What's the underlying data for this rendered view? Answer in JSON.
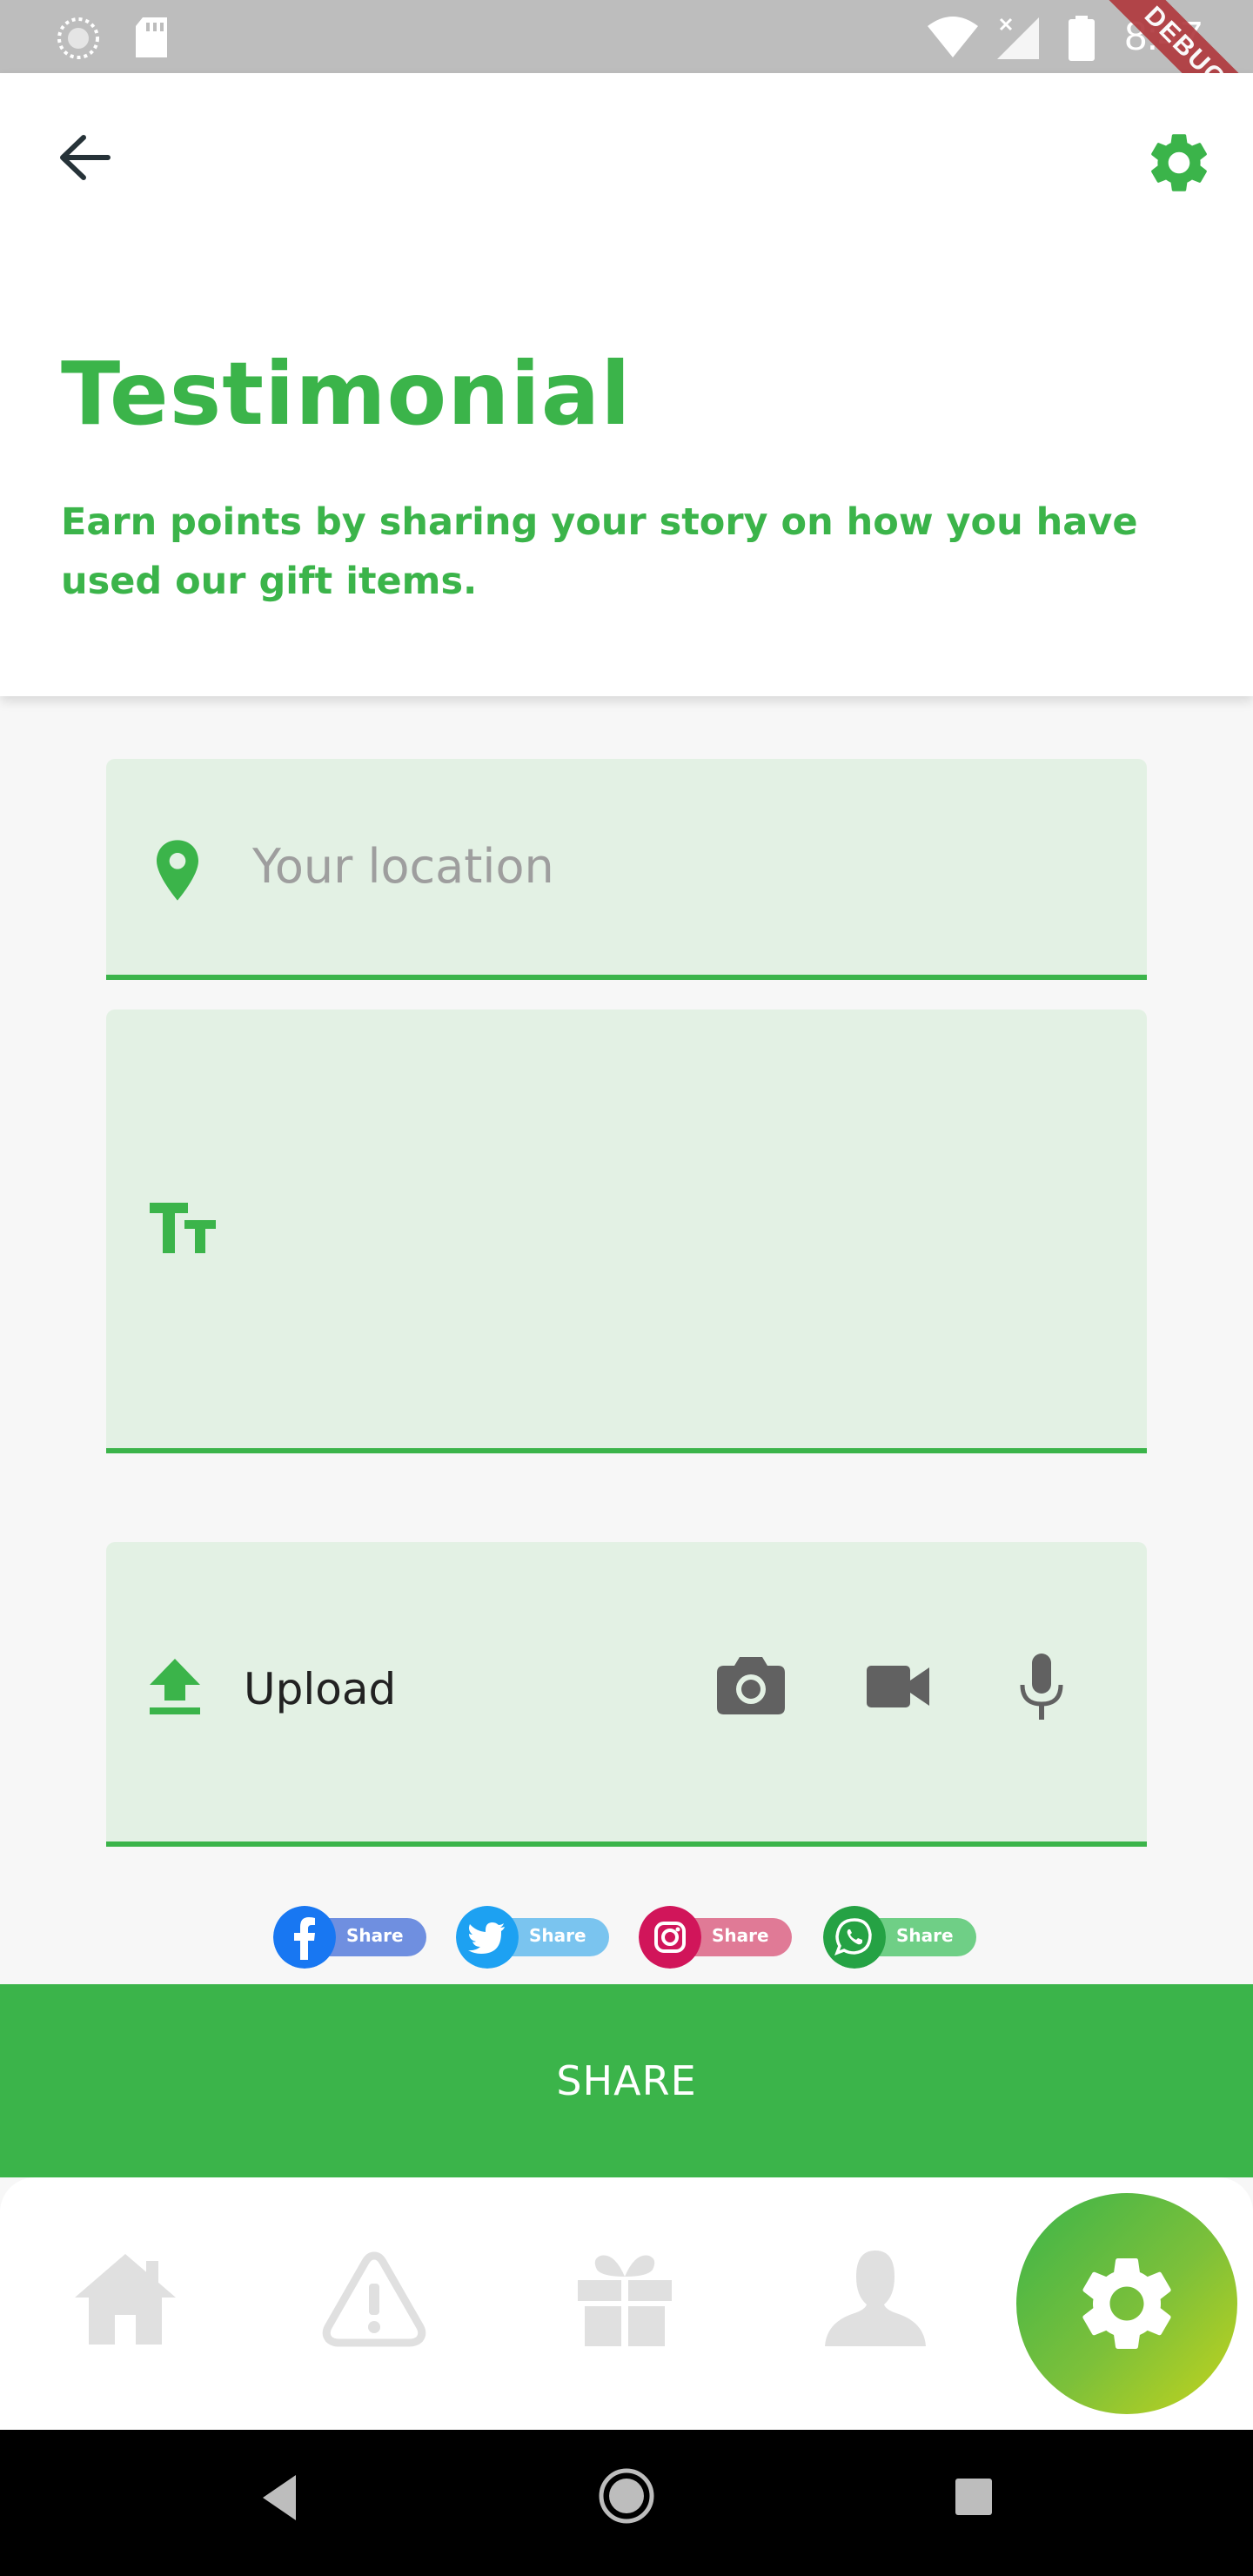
{
  "status_bar": {
    "time": "8:47",
    "debug_label": "DEBUG",
    "icons": [
      "spinner-icon",
      "sd-card-icon",
      "wifi-icon",
      "no-signal-icon",
      "battery-icon"
    ]
  },
  "header": {
    "back_icon": "arrow-back-icon",
    "settings_icon": "gear-icon",
    "title": "Testimonial",
    "subtitle": "Earn points by sharing your story on how you have used our gift items."
  },
  "form": {
    "location": {
      "icon": "location-pin-icon",
      "placeholder": "Your location",
      "value": ""
    },
    "story": {
      "icon": "text-size-icon",
      "value": ""
    },
    "upload": {
      "icon": "upload-icon",
      "label": "Upload",
      "actions": [
        "camera-icon",
        "video-camera-icon",
        "microphone-icon"
      ]
    }
  },
  "share_badges": [
    {
      "network": "facebook",
      "label": "Share",
      "color": "#1877f2"
    },
    {
      "network": "twitter",
      "label": "Share",
      "color": "#1da1f2"
    },
    {
      "network": "instagram",
      "label": "Share",
      "color": "#d1155a"
    },
    {
      "network": "whatsapp",
      "label": "Share",
      "color": "#25a244"
    }
  ],
  "share_button": {
    "label": "SHARE"
  },
  "bottom_nav": {
    "items": [
      "home-icon",
      "warning-icon",
      "gift-icon",
      "profile-icon"
    ],
    "active": "settings-icon"
  },
  "colors": {
    "accent": "#3bb44a",
    "field_bg": "#e3f1e4",
    "nav_inactive": "#e0e0e0"
  }
}
